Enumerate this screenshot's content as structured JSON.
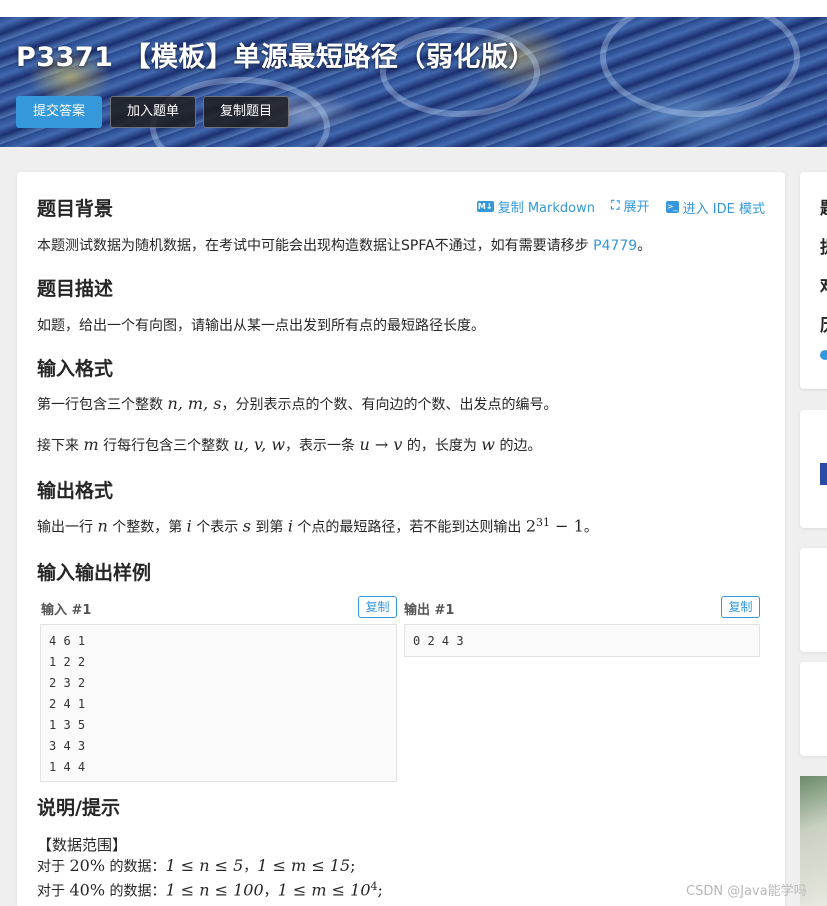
{
  "header": {
    "title": "P3371 【模板】单源最短路径（弱化版）",
    "buttons": {
      "submit": "提交答案",
      "add_to_list": "加入题单",
      "copy_problem": "复制题目"
    }
  },
  "toolbar": {
    "copy_markdown": "复制 Markdown",
    "expand": "展开",
    "ide_mode": "进入 IDE 模式",
    "markdown_icon_text": "M↓",
    "ide_icon_text": ">_"
  },
  "sections": {
    "background": {
      "title": "题目背景",
      "text": "本题测试数据为随机数据，在考试中可能会出现构造数据让SPFA不通过，如有需要请移步 ",
      "link": "P4779",
      "end": "。"
    },
    "description": {
      "title": "题目描述",
      "text": "如题，给出一个有向图，请输出从某一点出发到所有点的最短路径长度。"
    },
    "input_format": {
      "title": "输入格式",
      "line1_a": "第一行包含三个整数 ",
      "line1_math": "n, m, s",
      "line1_b": "，分别表示点的个数、有向边的个数、出发点的编号。",
      "line2_a": "接下来 ",
      "line2_m1": "m",
      "line2_b": " 行每行包含三个整数 ",
      "line2_m2": "u, v, w",
      "line2_c": "，表示一条 ",
      "line2_m3": "u → v",
      "line2_d": " 的，长度为 ",
      "line2_m4": "w",
      "line2_e": " 的边。"
    },
    "output_format": {
      "title": "输出格式",
      "a": "输出一行 ",
      "m1": "n",
      "b": " 个整数，第 ",
      "m2": "i",
      "c": " 个表示 ",
      "m3": "s",
      "d": " 到第 ",
      "m4": "i",
      "e": " 个点的最短路径，若不能到达则输出 ",
      "m5_base": "2",
      "m5_exp": "31",
      "m5_rest": " − 1",
      "f": "。"
    },
    "samples": {
      "title": "输入输出样例",
      "input_label": "输入 #1",
      "output_label": "输出 #1",
      "copy_label": "复制",
      "input_lines": [
        "4 6 1",
        "1 2 2",
        "2 3 2",
        "2 4 1",
        "1 3 5",
        "3 4 3",
        "1 4 4"
      ],
      "output_lines": [
        "0 2 4 3"
      ]
    },
    "hints": {
      "title": "说明/提示",
      "range_title": "【数据范围】",
      "r1_a": "对于 ",
      "r1_pct": "20%",
      "r1_b": " 的数据：",
      "r1_m1": "1 ≤ n ≤ 5",
      "r1_sep": "，",
      "r1_m2": "1 ≤ m ≤ 15",
      "r1_end": ";",
      "r2_a": "对于 ",
      "r2_pct": "40%",
      "r2_b": " 的数据：",
      "r2_m1": "1 ≤ n ≤ 100",
      "r2_sep": "，",
      "r2_m2a": "1 ≤ m ≤ 10",
      "r2_m2exp": "4",
      "r2_end": ";"
    }
  },
  "sidebar": {
    "chars": [
      "题",
      "提",
      "难",
      "历"
    ]
  },
  "watermark": "CSDN @Java能学吗"
}
